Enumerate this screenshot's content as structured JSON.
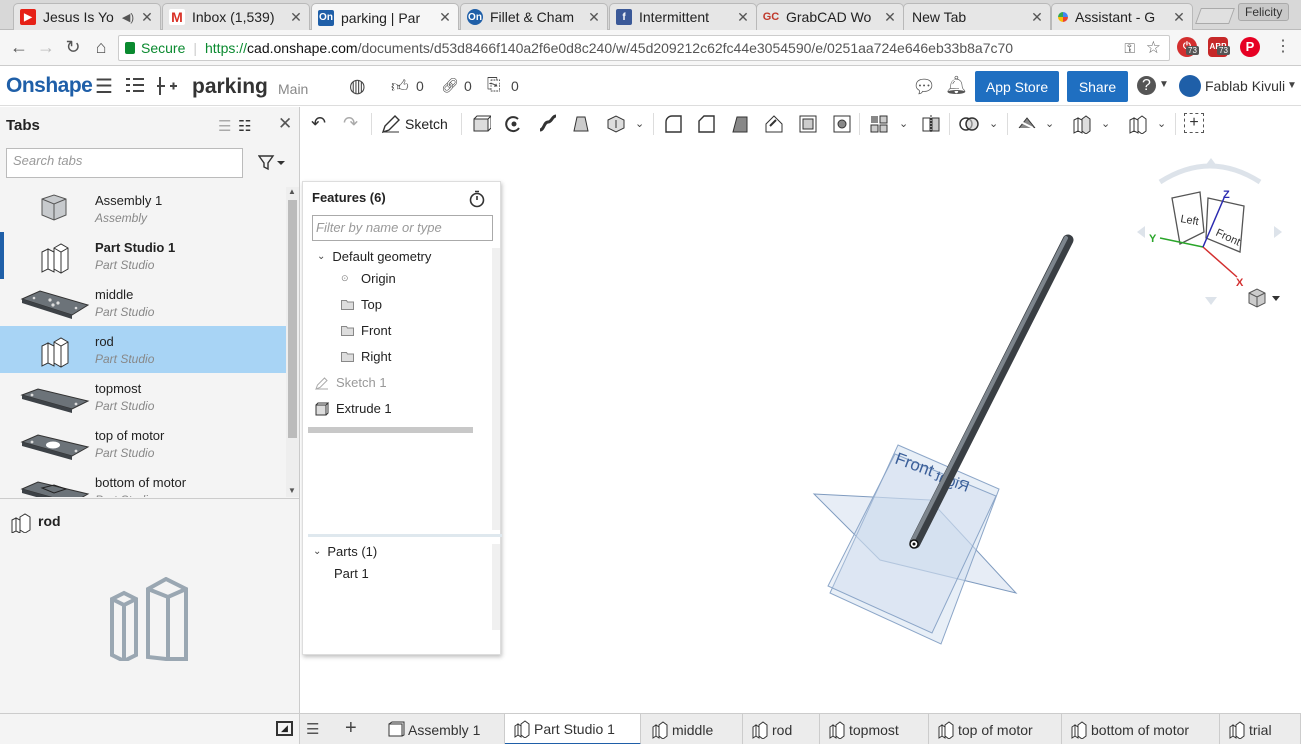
{
  "browser": {
    "tabs": [
      {
        "title": "Jesus Is Yo",
        "favicon": "youtube-icon",
        "color": "#e62117",
        "audio": true
      },
      {
        "title": "Inbox (1,539)",
        "favicon": "gmail-icon",
        "color": "#d93025"
      },
      {
        "title": "parking | Par",
        "favicon": "onshape-icon",
        "color": "#1f5fa8",
        "active": true
      },
      {
        "title": "Fillet & Cham",
        "favicon": "onshape-icon",
        "color": "#1f5fa8"
      },
      {
        "title": "Intermittent",
        "favicon": "facebook-icon",
        "color": "#3b5998"
      },
      {
        "title": "GrabCAD Wo",
        "favicon": "grabcad-icon",
        "color": "#c0392b"
      },
      {
        "title": "New Tab",
        "favicon": "",
        "color": ""
      },
      {
        "title": "Assistant - G",
        "favicon": "google-assistant-icon",
        "color": "#4285f4"
      }
    ],
    "profile": "Felicity",
    "secure_label": "Secure",
    "url_scheme": "https://",
    "url_host": "cad.onshape.com",
    "url_path": "/documents/d53d8466f140a2f6e0d8c240/w/45d209212c62fc44e3054590/e/0251aa724e646eb33b8a7c70",
    "ext_badges": [
      "73",
      "73"
    ]
  },
  "app": {
    "logo": "Onshape",
    "doc_name": "parking",
    "workspace": "Main",
    "likes": "0",
    "links": "0",
    "copies": "0",
    "app_store_label": "App Store",
    "share_label": "Share",
    "user_name": "Fablab Kivuli"
  },
  "tabs_panel": {
    "title": "Tabs",
    "search_placeholder": "Search tabs",
    "items": [
      {
        "name": "Assembly 1",
        "type": "Assembly",
        "thumb": "assembly"
      },
      {
        "name": "Part Studio 1",
        "type": "Part Studio",
        "thumb": "partstudio",
        "current": true
      },
      {
        "name": "middle",
        "type": "Part Studio",
        "thumb": "plate-holes"
      },
      {
        "name": "rod",
        "type": "Part Studio",
        "thumb": "partstudio",
        "selected": true
      },
      {
        "name": "topmost",
        "type": "Part Studio",
        "thumb": "plate"
      },
      {
        "name": "top of motor",
        "type": "Part Studio",
        "thumb": "plate-hole"
      },
      {
        "name": "bottom of motor",
        "type": "Part Studio",
        "thumb": "plate-slot"
      }
    ],
    "preview_name": "rod"
  },
  "toolbar": {
    "sketch_label": "Sketch"
  },
  "features": {
    "title": "Features (6)",
    "filter_placeholder": "Filter by name or type",
    "default_geometry": "Default geometry",
    "items": [
      "Origin",
      "Top",
      "Front",
      "Right"
    ],
    "sketch": "Sketch 1",
    "extrude": "Extrude 1",
    "parts_header": "Parts (1)",
    "parts": [
      "Part 1"
    ]
  },
  "viewport": {
    "plane_front": "Front",
    "plane_right": "Right",
    "cube_left": "Left",
    "cube_front": "Front",
    "axis_x": "X",
    "axis_y": "Y",
    "axis_z": "Z"
  },
  "bottom_tabs": [
    {
      "label": "Assembly 1",
      "icon": "assembly-icon"
    },
    {
      "label": "Part Studio 1",
      "icon": "partstudio-icon",
      "active": true
    },
    {
      "label": "middle",
      "icon": "partstudio-icon"
    },
    {
      "label": "rod",
      "icon": "partstudio-icon"
    },
    {
      "label": "topmost",
      "icon": "partstudio-icon"
    },
    {
      "label": "top of motor",
      "icon": "partstudio-icon"
    },
    {
      "label": "bottom of motor",
      "icon": "partstudio-icon"
    },
    {
      "label": "trial",
      "icon": "partstudio-icon"
    }
  ]
}
